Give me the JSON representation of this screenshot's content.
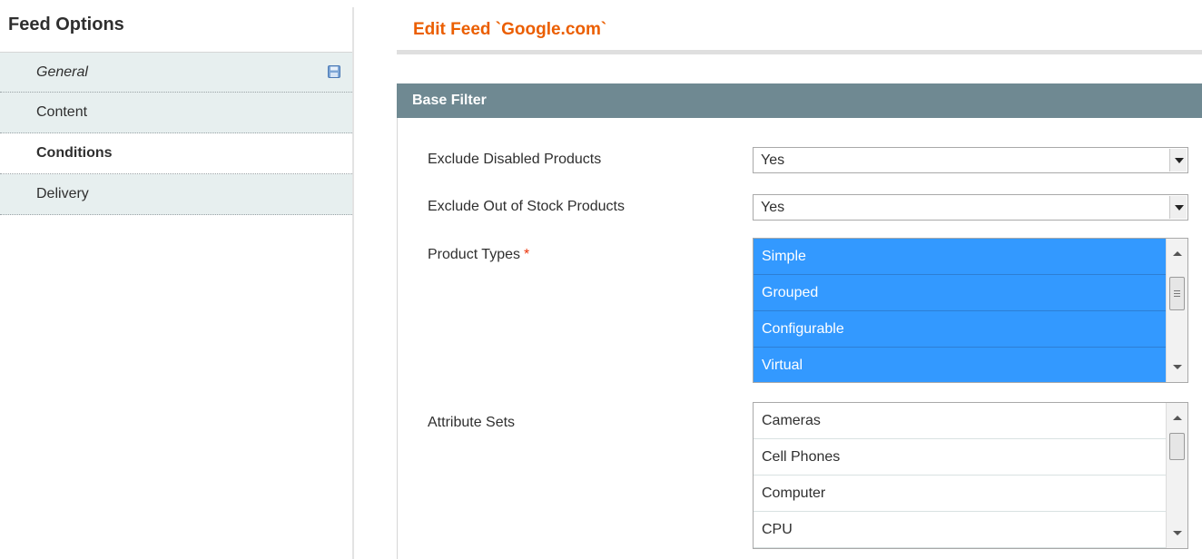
{
  "sidebar": {
    "title": "Feed Options",
    "tabs": [
      {
        "label": "General",
        "state": "inactive",
        "italic": true,
        "icon": "save-icon"
      },
      {
        "label": "Content",
        "state": "inactive"
      },
      {
        "label": "Conditions",
        "state": "active"
      },
      {
        "label": "Delivery",
        "state": "inactive"
      }
    ]
  },
  "main": {
    "title": "Edit Feed `Google.com`",
    "fieldset": {
      "title": "Base Filter",
      "fields": {
        "exclude_disabled": {
          "label": "Exclude Disabled Products",
          "value": "Yes"
        },
        "exclude_out_of_stock": {
          "label": "Exclude Out of Stock Products",
          "value": "Yes"
        },
        "product_types": {
          "label": "Product Types",
          "required_mark": "*",
          "options": [
            "Simple",
            "Grouped",
            "Configurable",
            "Virtual"
          ]
        },
        "attribute_sets": {
          "label": "Attribute Sets",
          "options": [
            "Cameras",
            "Cell Phones",
            "Computer",
            "CPU"
          ]
        }
      }
    }
  },
  "colors": {
    "accent_orange": "#eb5e00",
    "header_bar": "#6f8992",
    "selected_option": "#3399ff",
    "tab_inactive_bg": "#e7efef"
  }
}
